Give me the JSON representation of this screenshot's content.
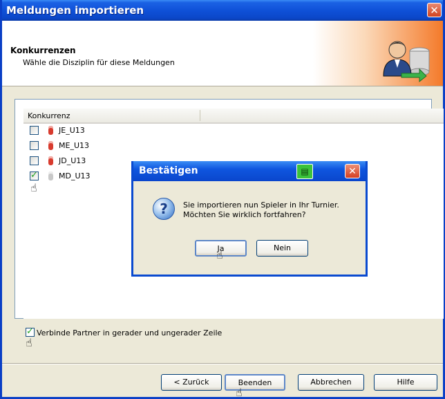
{
  "window": {
    "title": "Meldungen importieren"
  },
  "header": {
    "title": "Konkurrenzen",
    "subtitle": "Wähle die Disziplin für diese Meldungen",
    "icon": "user-database-icon"
  },
  "list": {
    "column_header": "Konkurrenz",
    "items": [
      {
        "label": "JE_U13",
        "checked": false
      },
      {
        "label": "ME_U13",
        "checked": false
      },
      {
        "label": "JD_U13",
        "checked": false
      },
      {
        "label": "MD_U13",
        "checked": true
      }
    ]
  },
  "dialog": {
    "title": "Bestätigen",
    "line1": "Sie importieren nun Spieler in Ihr Turnier.",
    "line2": "Möchten Sie wirklich fortfahren?",
    "yes_label": "Ja",
    "no_label": "Nein"
  },
  "options": {
    "pair_label": "Verbinde Partner in gerader und ungerader Zeile",
    "pair_checked": true
  },
  "footer": {
    "back_label": "< Zurück",
    "finish_label": "Beenden",
    "cancel_label": "Abbrechen",
    "help_label": "Hilfe"
  },
  "colors": {
    "titlebar": "#0b46c8",
    "header_accent": "#f47a2a",
    "checkmark": "#21a121"
  }
}
